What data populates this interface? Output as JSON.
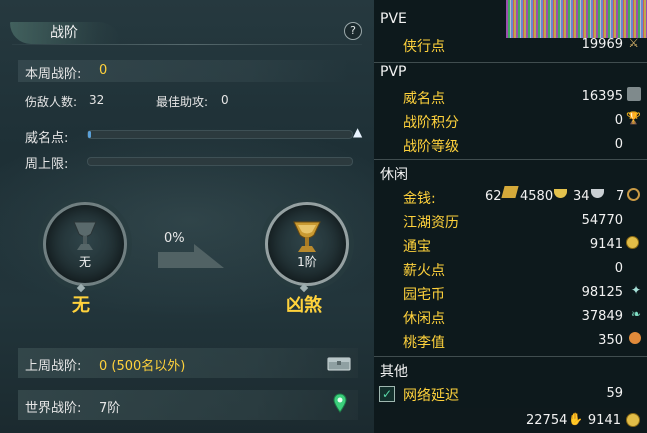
{
  "panel": {
    "title": "战阶",
    "help_label": "?",
    "current_rank_label": "本周战阶:",
    "current_rank_value": "0",
    "kills_label": "伤敌人数:",
    "kills_value": "32",
    "assists_label": "最佳助攻:",
    "assists_value": "0",
    "prestige_label": "威名点:",
    "prestige_progress": 0.0,
    "weekly_cap_label": "周上限:",
    "weekly_cap_progress": 0.0,
    "progress_percent": "0%",
    "current_tier_small": "无",
    "current_tier_name": "无",
    "next_tier_small": "1阶",
    "next_tier_name": "凶煞",
    "last_week_label": "上周战阶:",
    "last_week_value": "0 (500名以外)",
    "world_rank_label": "世界战阶:",
    "world_rank_value": "7阶"
  },
  "stats": {
    "pve_header": "PVE",
    "pve_items": [
      {
        "label": "侠行点",
        "value": "19969"
      }
    ],
    "pvp_header": "PVP",
    "pvp_items": [
      {
        "label": "威名点",
        "value": "16395"
      },
      {
        "label": "战阶积分",
        "value": "0"
      },
      {
        "label": "战阶等级",
        "value": "0"
      }
    ],
    "leisure_header": "休闲",
    "money_label": "金钱:",
    "money_parts": [
      "62",
      "4580",
      "34",
      "7"
    ],
    "leisure_items": [
      {
        "label": "江湖资历",
        "value": "54770"
      },
      {
        "label": "通宝",
        "value": "9141"
      },
      {
        "label": "薪火点",
        "value": "0"
      },
      {
        "label": "园宅币",
        "value": "98125"
      },
      {
        "label": "休闲点",
        "value": "37849"
      },
      {
        "label": "桃李值",
        "value": "350"
      }
    ],
    "other_header": "其他",
    "latency_label": "网络延迟",
    "latency_value": "59",
    "footer_left": "22754",
    "footer_right": "9141"
  },
  "colors": {
    "accent_gold": "#ffd23c",
    "progress_blue": "#5aa0d8"
  }
}
